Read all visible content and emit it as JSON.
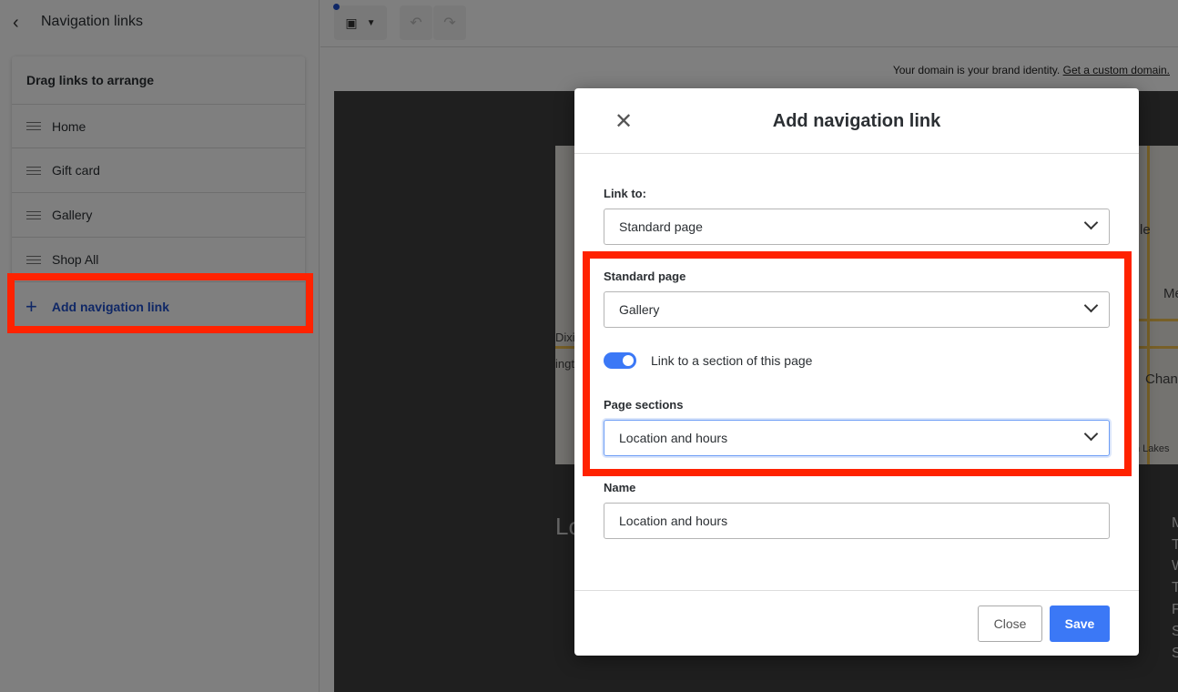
{
  "sidebar": {
    "title": "Navigation links",
    "card_title": "Drag links to arrange",
    "items": [
      {
        "label": "Home"
      },
      {
        "label": "Gift card"
      },
      {
        "label": "Gallery"
      },
      {
        "label": "Shop All"
      }
    ],
    "add_link_label": "Add navigation link"
  },
  "topbar": {
    "device_icon": "desktop-icon",
    "undo_icon": "undo-icon",
    "redo_icon": "redo-icon"
  },
  "domain_notice": {
    "text": "Your domain is your brand identity.",
    "link": "Get a custom domain."
  },
  "preview": {
    "map_labels": [
      "Dixi",
      "ingt",
      "le",
      "Me",
      "Chan",
      "n Lakes"
    ],
    "heading_fragment": "Lo",
    "day_initials": [
      "M",
      "T",
      "W",
      "T",
      "F",
      "S",
      "S"
    ]
  },
  "modal": {
    "title": "Add navigation link",
    "link_to_label": "Link to:",
    "link_to_value": "Standard page",
    "standard_page_label": "Standard page",
    "standard_page_value": "Gallery",
    "toggle_label": "Link to a section of this page",
    "toggle_on": true,
    "page_sections_label": "Page sections",
    "page_sections_value": "Location and hours",
    "name_label": "Name",
    "name_value": "Location and hours",
    "close_label": "Close",
    "save_label": "Save"
  },
  "colors": {
    "accent": "#3b78f6",
    "link": "#1f4fcc",
    "annotation": "#ff2200"
  }
}
